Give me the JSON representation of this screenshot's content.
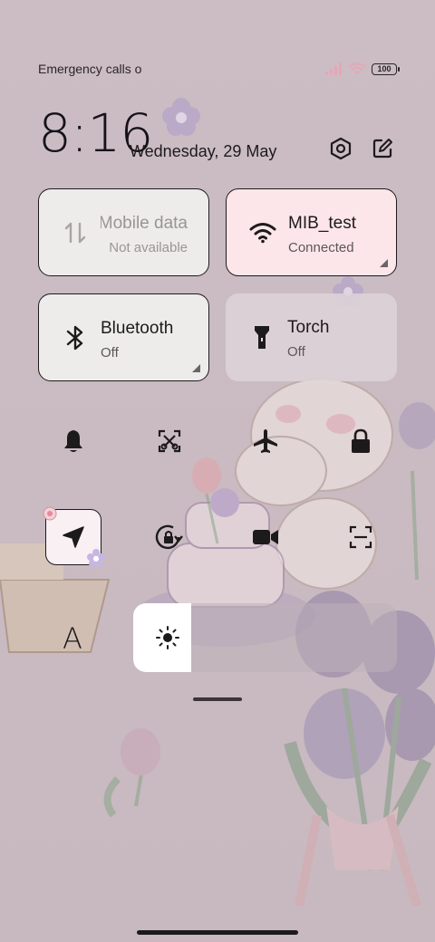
{
  "status_bar": {
    "carrier_text": "Emergency calls o",
    "battery_level": "100",
    "icons": [
      "signal-icon",
      "wifi-icon",
      "battery-icon"
    ]
  },
  "header": {
    "time": "8:16",
    "date": "Wednesday, 29 May",
    "settings_icon": "hexagon-settings-icon",
    "edit_icon": "edit-icon"
  },
  "tiles": [
    {
      "id": "mobile-data",
      "title": "Mobile data",
      "subtitle": "Not available",
      "state": "disabled",
      "icon": "data-arrows-icon"
    },
    {
      "id": "wifi",
      "title": "MIB_test",
      "subtitle": "Connected",
      "state": "on",
      "icon": "wifi-icon"
    },
    {
      "id": "bluetooth",
      "title": "Bluetooth",
      "subtitle": "Off",
      "state": "off",
      "icon": "bluetooth-icon"
    },
    {
      "id": "torch",
      "title": "Torch",
      "subtitle": "Off",
      "state": "off",
      "icon": "torch-icon"
    }
  ],
  "toggles_row1": [
    "bell-icon",
    "screenshot-icon",
    "airplane-icon",
    "lock-icon"
  ],
  "toggles_row2": [
    "location-icon",
    "rotation-lock-icon",
    "screen-record-icon",
    "scan-icon"
  ],
  "location_active": true,
  "brightness": {
    "font_label": "A",
    "level": 0.22,
    "icon": "sun-icon"
  },
  "colors": {
    "wifi_tile_bg": "#fde6e9",
    "tile_bg": "#eeeceb",
    "inactive_tile_bg": "#dcd1d5",
    "background": "#cbbdc3"
  }
}
